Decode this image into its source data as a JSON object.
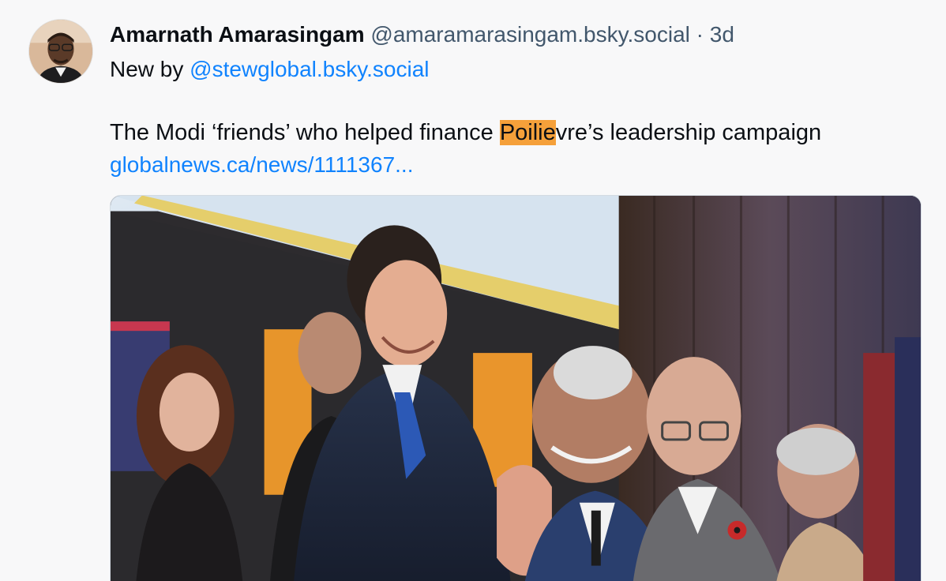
{
  "post": {
    "author_name": "Amarnath Amarasingam",
    "author_handle": "@amaramarasingam.bsky.social",
    "separator": "·",
    "time": "3d",
    "intro_text": "New by",
    "mention": "@stewglobal.bsky.social",
    "headline_before": "The Modi ‘friends’ who helped finance ",
    "headline_highlight": "Poilie",
    "headline_after": "vre’s leadership campaign",
    "link_text": "globalnews.ca/news/1111367...",
    "highlight_color": "#f5a03a",
    "link_color": "#1083fe"
  },
  "embed": {
    "image_icon": "photo-thumbnail"
  }
}
